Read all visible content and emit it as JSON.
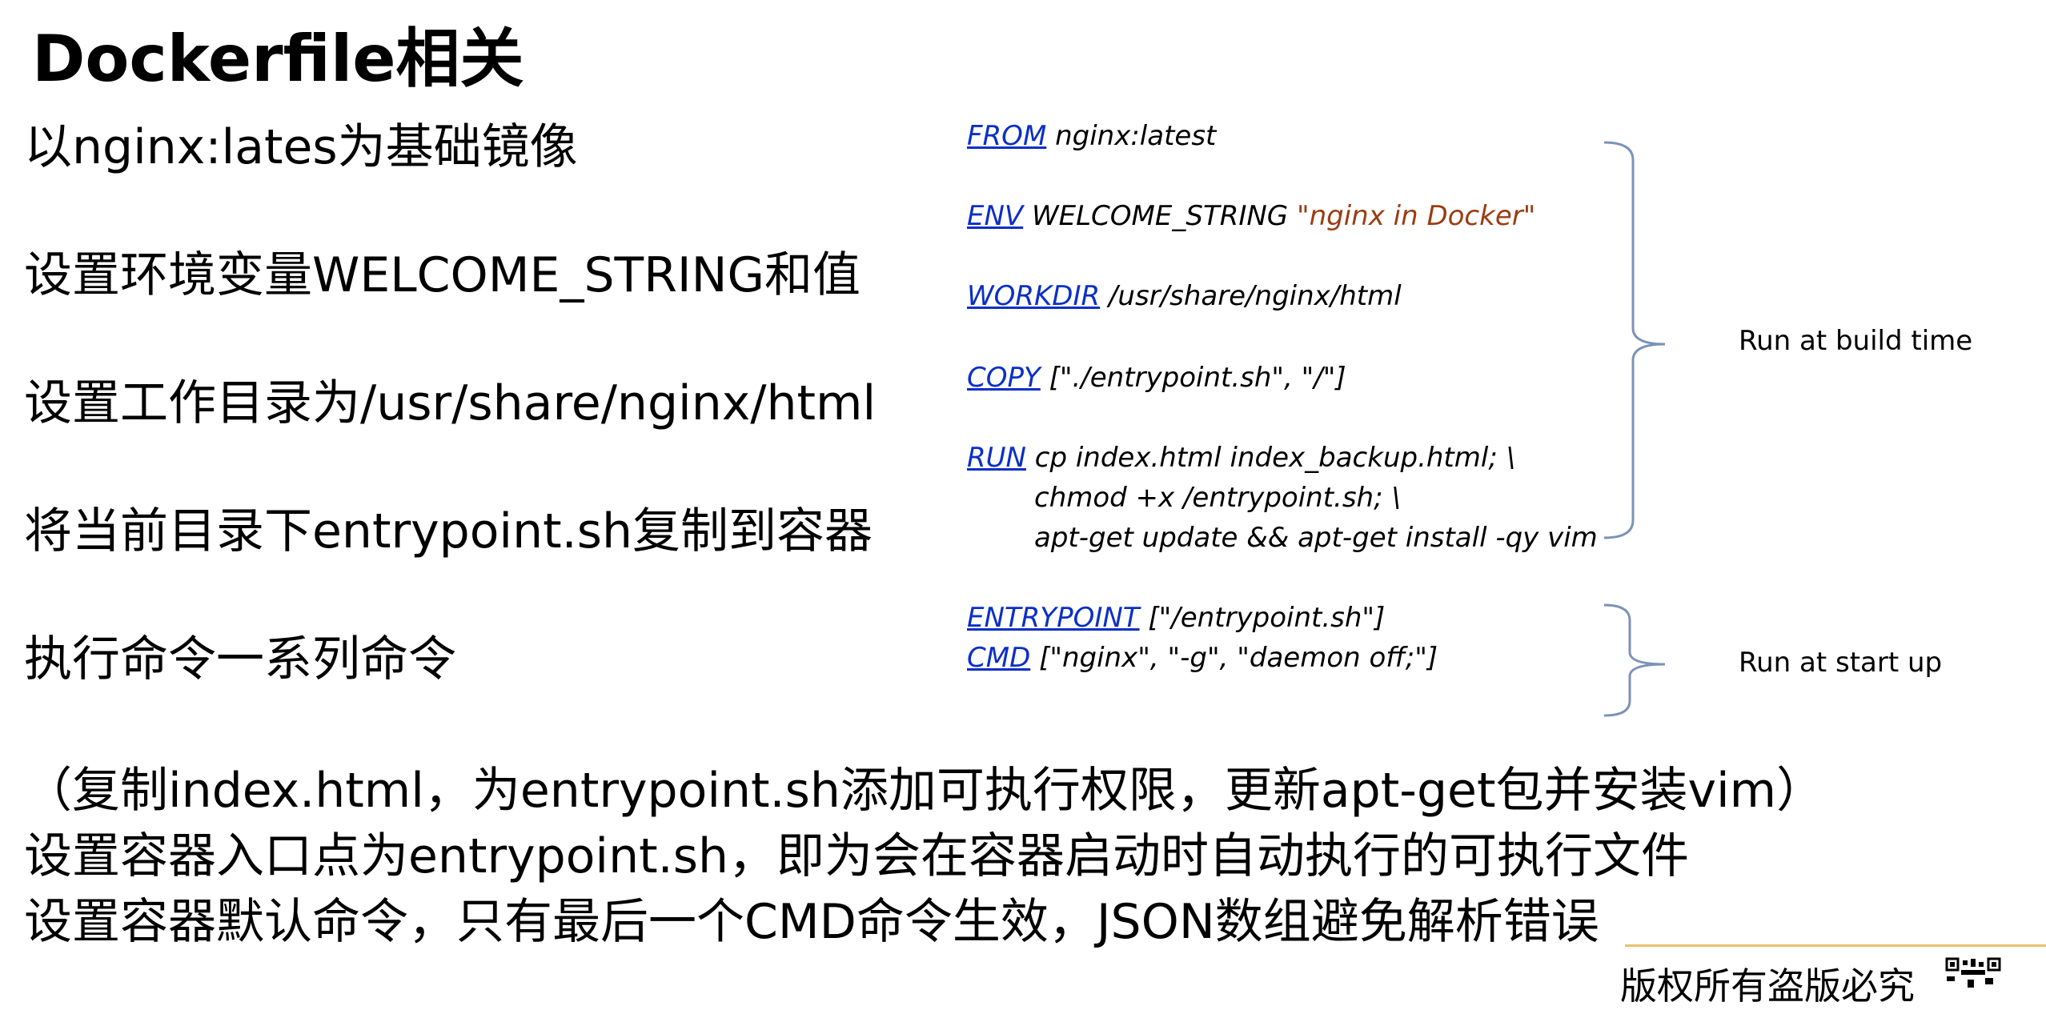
{
  "title": "Dockerfile相关",
  "descriptions": [
    "以nginx:lates为基础镜像",
    "设置环境变量WELCOME_STRING和值",
    "设置工作目录为/usr/share/nginx/html",
    "将当前目录下entrypoint.sh复制到容器",
    "执行命令一系列命令"
  ],
  "code": {
    "from_kw": "FROM",
    "from_arg": " nginx:latest",
    "env_kw": "ENV",
    "env_arg": " WELCOME_STRING ",
    "env_val": "\"nginx in Docker\"",
    "workdir_kw": "WORKDIR",
    "workdir_arg": " /usr/share/nginx/html",
    "copy_kw": "COPY",
    "copy_arg": " [\"./entrypoint.sh\", \"/\"]",
    "run_kw": "RUN",
    "run_line1": " cp index.html index_backup.html; \\",
    "run_line2": "chmod +x /entrypoint.sh; \\",
    "run_line3": "apt-get update && apt-get install -qy vim",
    "entrypoint_kw": "ENTRYPOINT",
    "entrypoint_arg": " [\"/entrypoint.sh\"]",
    "cmd_kw": "CMD",
    "cmd_arg": " [\"nginx\", \"-g\", \"daemon off;\"]"
  },
  "labels": {
    "build": "Run at build time",
    "startup": "Run at start up"
  },
  "bottom_lines": [
    "（复制index.html，为entrypoint.sh添加可执行权限，更新apt-get包并安装vim）",
    "设置容器入口点为entrypoint.sh，即为会在容器启动时自动执行的可执行文件",
    "设置容器默认命令，只有最后一个CMD命令生效，JSON数组避免解析错误"
  ],
  "footer": "版权所有盗版必究",
  "colors": {
    "keyword": "#0b2fc7",
    "string": "#9a3d13",
    "brace": "#7b93b8"
  }
}
